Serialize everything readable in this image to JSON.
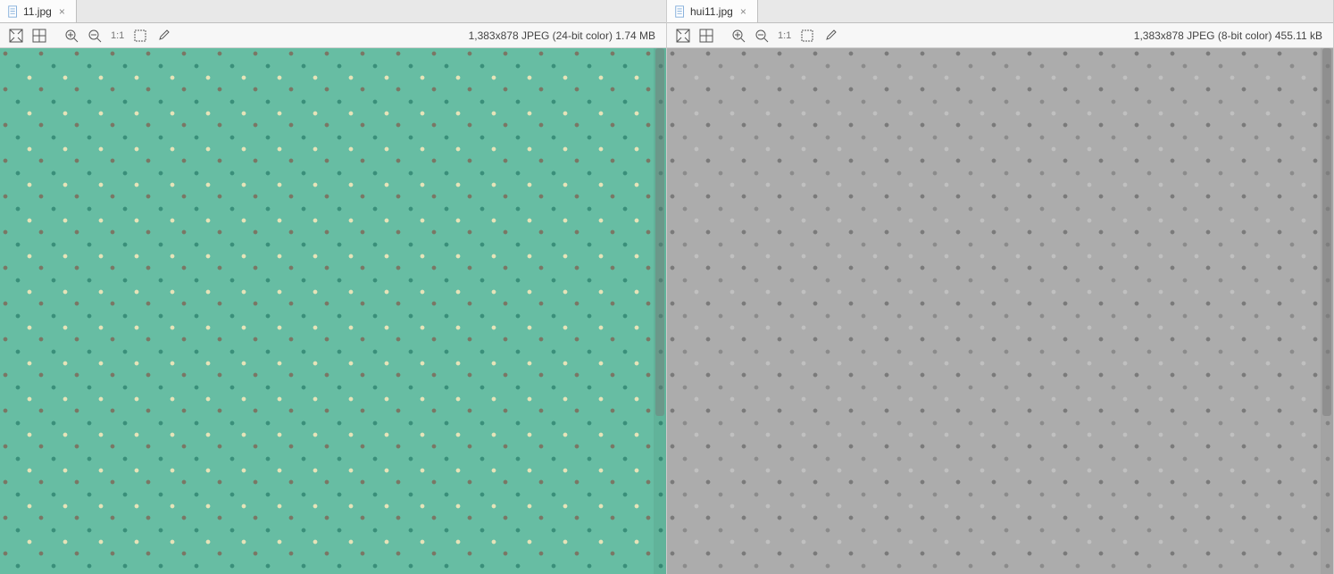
{
  "panes": [
    {
      "tab": {
        "filename": "11.jpg"
      },
      "toolbar": {
        "zoom_label": "1:1"
      },
      "status": "1,383x878 JPEG (24-bit color) 1.74 MB",
      "surface": "green"
    },
    {
      "tab": {
        "filename": "hui11.jpg"
      },
      "toolbar": {
        "zoom_label": "1:1"
      },
      "status": "1,383x878 JPEG (8-bit color) 455.11 kB",
      "surface": "gray"
    }
  ],
  "icons": {
    "file": "file-icon",
    "close": "×"
  }
}
